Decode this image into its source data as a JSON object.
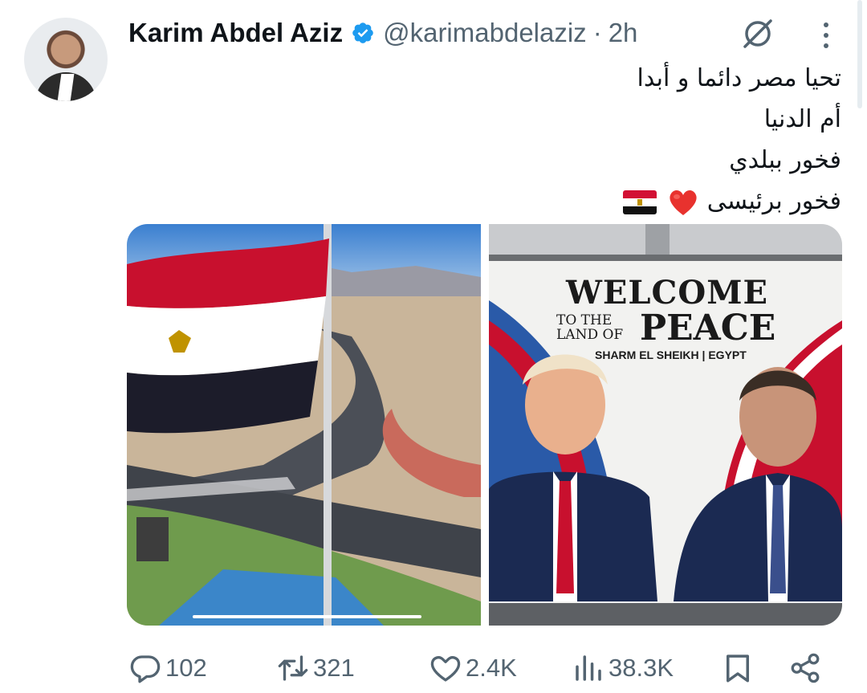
{
  "author": {
    "name": "Karim Abdel Aziz",
    "handle": "@karimabdelaziz",
    "separator": "·",
    "time": "2h",
    "verified": true,
    "verified_color": "#1d9bf0"
  },
  "tweet": {
    "lines": [
      "تحيا مصر دائما و أبدا",
      "أم الدنيا",
      "فخور ببلدي",
      "فخور برئيسى"
    ],
    "last_line_emojis": [
      "heart-emoji",
      "egypt-flag-emoji"
    ]
  },
  "media": {
    "left": {
      "kind": "photo",
      "subject": "egypt-flag-over-roundabout"
    },
    "right": {
      "kind": "photo",
      "subject": "billboard",
      "billboard_title": "WELCOME",
      "billboard_to_the": "TO THE",
      "billboard_land_of": "LAND OF",
      "billboard_peace": "PEACE",
      "billboard_location": "SHARM EL SHEIKH | EGYPT"
    }
  },
  "actions": {
    "replies": "102",
    "retweets": "321",
    "likes": "2.4K",
    "views": "38.3K"
  },
  "icons": {
    "verified": "verified-badge-icon",
    "grok": "grok-icon",
    "more": "more-vertical-icon",
    "reply": "reply-icon",
    "retweet": "retweet-icon",
    "like": "heart-icon",
    "views": "views-icon",
    "bookmark": "bookmark-icon",
    "share": "share-icon"
  },
  "colors": {
    "text_primary": "#0f1419",
    "text_secondary": "#536471",
    "accent": "#1d9bf0"
  }
}
